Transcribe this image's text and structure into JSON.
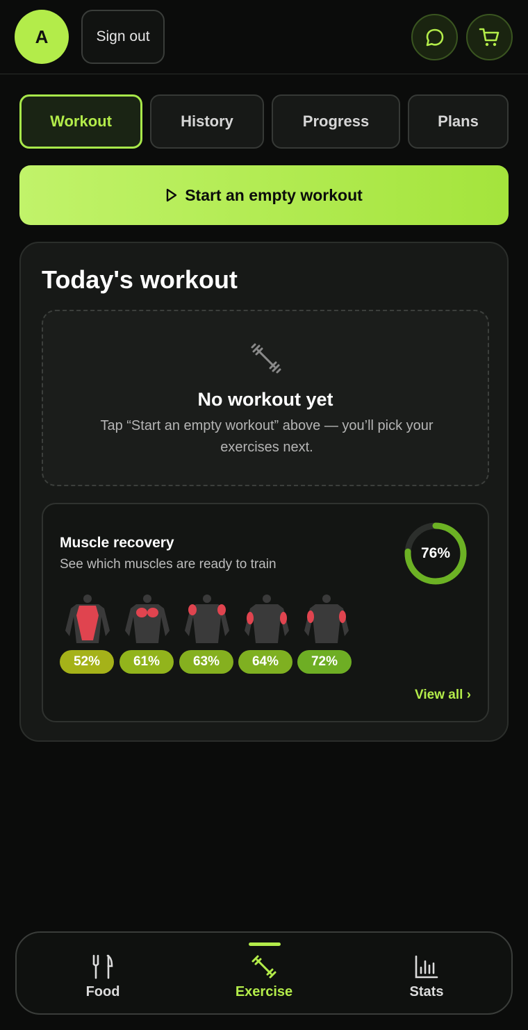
{
  "header": {
    "avatar_initial": "A",
    "signout_label": "Sign out",
    "chat_icon": "chat-bubble-icon",
    "cart_icon": "cart-icon"
  },
  "tabs": [
    {
      "label": "Workout",
      "active": true
    },
    {
      "label": "History",
      "active": false
    },
    {
      "label": "Progress",
      "active": false
    },
    {
      "label": "Plans",
      "active": false
    }
  ],
  "start_button": {
    "label": "Start an empty workout",
    "icon": "play-icon"
  },
  "today": {
    "title": "Today's workout",
    "empty_icon": "dumbbell-icon",
    "empty_title": "No workout yet",
    "empty_subtitle": "Tap “Start an empty workout” above — you’ll pick your exercises next."
  },
  "recovery": {
    "title": "Muscle recovery",
    "subtitle": "See which muscles are ready to train",
    "overall_percent": "76%",
    "overall_value": 76,
    "muscles": [
      {
        "percent": "52%",
        "value": 52,
        "badge_color": "#a5b219"
      },
      {
        "percent": "61%",
        "value": 61,
        "badge_color": "#92b41c"
      },
      {
        "percent": "63%",
        "value": 63,
        "badge_color": "#85b01f"
      },
      {
        "percent": "64%",
        "value": 64,
        "badge_color": "#7fb021"
      },
      {
        "percent": "72%",
        "value": 72,
        "badge_color": "#6eae24"
      }
    ],
    "view_all_label": "View all ›"
  },
  "bottom_nav": [
    {
      "label": "Food",
      "icon": "fork-knife-icon",
      "active": false
    },
    {
      "label": "Exercise",
      "icon": "dumbbell-icon",
      "active": true
    },
    {
      "label": "Stats",
      "icon": "bar-chart-icon",
      "active": false
    }
  ],
  "colors": {
    "accent": "#b3ec4a",
    "background": "#0b0c0b",
    "card": "#171917",
    "muscle_highlight": "#e0444f"
  }
}
